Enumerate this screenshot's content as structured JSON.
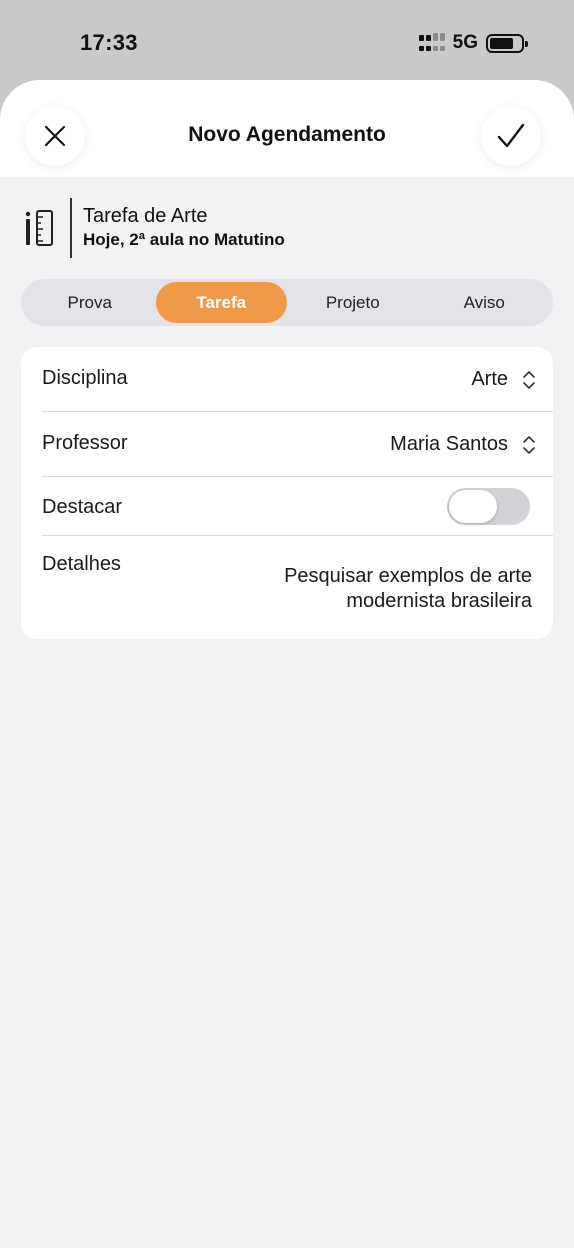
{
  "status_bar": {
    "time": "17:33",
    "network": "5G",
    "battery_level": 0.75
  },
  "header": {
    "title": "Novo Agendamento",
    "close_icon": "close-icon",
    "confirm_icon": "checkmark-icon"
  },
  "summary": {
    "icon": "pencil-ruler-icon",
    "title": "Tarefa de Arte",
    "subtitle": "Hoje, 2ª aula no Matutino"
  },
  "segments": [
    {
      "label": "Prova",
      "active": false
    },
    {
      "label": "Tarefa",
      "active": true
    },
    {
      "label": "Projeto",
      "active": false
    },
    {
      "label": "Aviso",
      "active": false
    }
  ],
  "form": {
    "discipline": {
      "label": "Disciplina",
      "value": "Arte"
    },
    "teacher": {
      "label": "Professor",
      "value": "Maria Santos"
    },
    "highlight": {
      "label": "Destacar",
      "on": false
    },
    "details": {
      "label": "Detalhes",
      "value": "Pesquisar exemplos de arte modernista brasileira"
    }
  },
  "colors": {
    "accent": "#ef9a4a",
    "sheet_background": "#f1f2f4",
    "toggle_off": "#d1d2d5"
  }
}
